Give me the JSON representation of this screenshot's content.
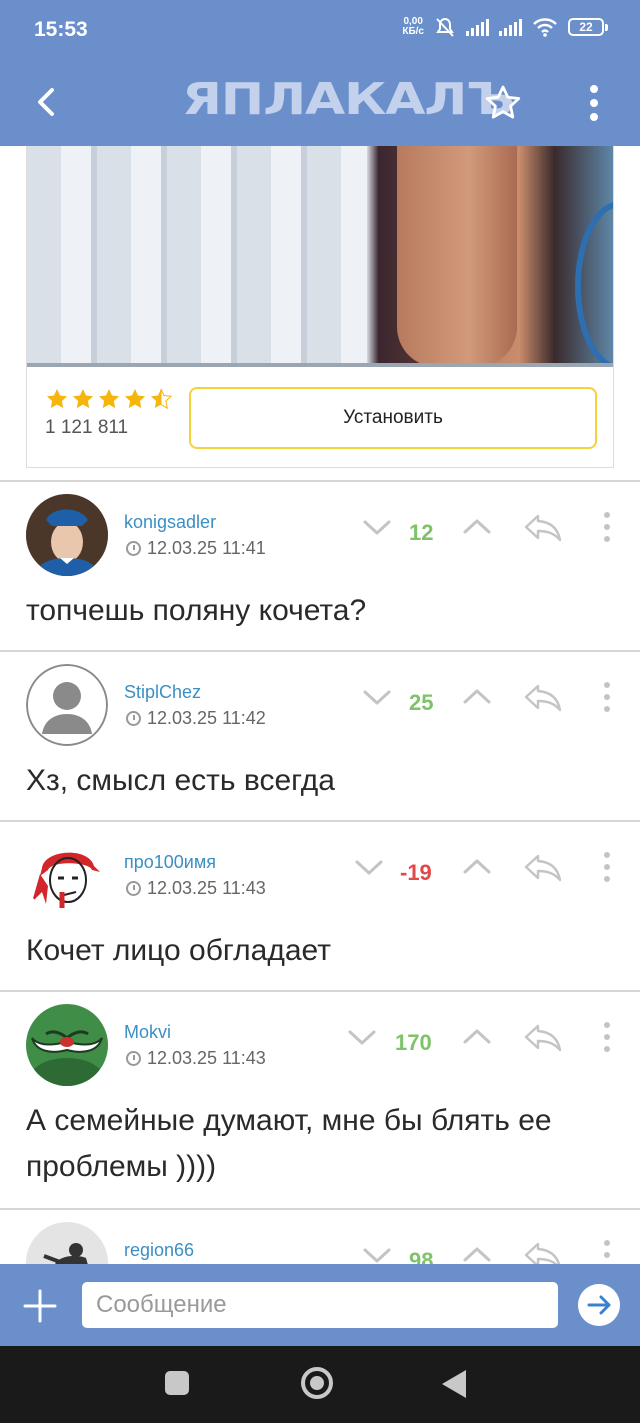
{
  "status_bar": {
    "time": "15:53",
    "net_speed_value": "0,00",
    "net_speed_unit": "КБ/с",
    "battery": "22",
    "icons": [
      "mute-icon",
      "signal-icon",
      "signal-icon",
      "wifi-icon",
      "battery-icon"
    ]
  },
  "app_bar": {
    "logo": "ЯПЛАКАЛЪ",
    "back_icon": "chevron-left-icon",
    "favorite_icon": "star-icon",
    "menu_icon": "more-vertical-icon"
  },
  "ad": {
    "rating_stars": 4.5,
    "rating_count": "1 121 811",
    "install_label": "Установить"
  },
  "comments": [
    {
      "author": "konigsadler",
      "time": "12.03.25 11:41",
      "score": "12",
      "score_color": "#7fc26a",
      "text": "топчешь поляну кочета?"
    },
    {
      "author": "StiplChez",
      "time": "12.03.25 11:42",
      "score": "25",
      "score_color": "#7fc26a",
      "text": "Хз, смысл есть всегда"
    },
    {
      "author": "про100имя",
      "time": "12.03.25 11:43",
      "score": "-19",
      "score_color": "#e0494a",
      "text": "Кочет лицо обгладает"
    },
    {
      "author": "Mokvi",
      "time": "12.03.25 11:43",
      "score": "170",
      "score_color": "#7fc26a",
      "text": "А семейные думают, мне бы блять ее проблемы ))))"
    },
    {
      "author": "region66",
      "time": "",
      "score": "98",
      "score_color": "#7fc26a",
      "text": ""
    }
  ],
  "composer": {
    "placeholder": "Сообщение",
    "add_icon": "plus-icon",
    "send_icon": "send-arrow-icon"
  },
  "colors": {
    "accent": "#6a8fca",
    "author_link": "#3a8fc4",
    "positive": "#7fc26a",
    "negative": "#e0494a",
    "install_border": "#f3d23a"
  }
}
